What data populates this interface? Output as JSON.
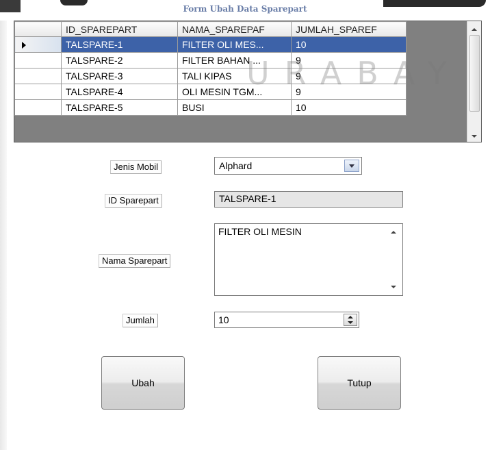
{
  "window": {
    "title": "Form Ubah Data Sparepart"
  },
  "watermark": {
    "text": "SURABAYA",
    "visible": "URABAY"
  },
  "grid": {
    "columns": [
      "ID_SPAREPART",
      "NAMA_SPAREPAF",
      "JUMLAH_SPAREF"
    ],
    "rows": [
      {
        "id": "TALSPARE-1",
        "nama": "FILTER OLI MES...",
        "jumlah": "10",
        "selected": true
      },
      {
        "id": "TALSPARE-2",
        "nama": "FILTER BAHAN ...",
        "jumlah": "9"
      },
      {
        "id": "TALSPARE-3",
        "nama": "TALI KIPAS",
        "jumlah": "9"
      },
      {
        "id": "TALSPARE-4",
        "nama": "OLI MESIN TGM...",
        "jumlah": "9"
      },
      {
        "id": "TALSPARE-5",
        "nama": "BUSI",
        "jumlah": "10"
      }
    ]
  },
  "form": {
    "jenis_mobil_label": "Jenis Mobil",
    "jenis_mobil_value": "Alphard",
    "id_label": "ID Sparepart",
    "id_value": "TALSPARE-1",
    "nama_label": "Nama Sparepart",
    "nama_value": "FILTER OLI MESIN",
    "jumlah_label": "Jumlah",
    "jumlah_value": "10"
  },
  "buttons": {
    "ubah": "Ubah",
    "tutup": "Tutup"
  },
  "colors": {
    "selection": "#3d62a8",
    "title": "#6a7ea8"
  }
}
